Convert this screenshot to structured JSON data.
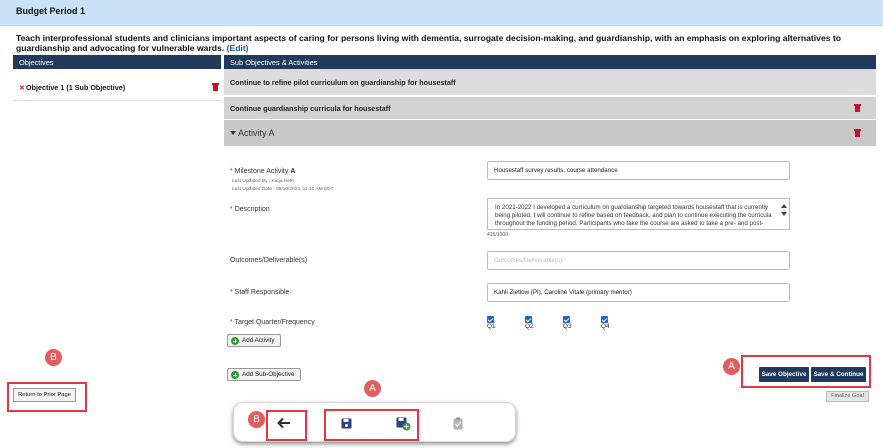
{
  "header": {
    "period_title": "Budget Period 1",
    "goal_text": "Teach interprofessional students and clinicians important aspects of caring for persons living with dementia, surrogate decision-making, and guardianship, with an emphasis on exploring alternatives to guardianship and advocating for vulnerable wards.",
    "edit_link": "(Edit)"
  },
  "columns": {
    "objectives": "Objectives",
    "sub_objectives": "Sub Objectives & Activities"
  },
  "objectives": [
    {
      "label": "Objective 1 (1 Sub Objective)"
    }
  ],
  "sub_objective": {
    "parent_label": "Continue to refine pilot curriculum on guardianship for housestaff",
    "label": "Continue guardianship curricula for housestaff"
  },
  "activity": {
    "title": "Activity A",
    "milestone_label": "Milestone Activity",
    "milestone_letter": "A",
    "last_updated_by": "Last Updated By : Katja Heth",
    "last_updated_date": "Last Updated Date : 08/10/2023, 11:10 AM EDT",
    "milestone_value": "Housestaff survey results, course attendance",
    "description_label": "Description",
    "description_value": "In 2021-2022 I developed a curriculum on guardianship targeted towards housestaff that is currently being piloted. I will continue to refine based on feedback, and plan to continue executing the curricula throughout the funding period. Participants who take the course are asked to take a pre- and post-",
    "char_count": "415/1000",
    "outcomes_label": "Outcomes/Deliverable(s)",
    "outcomes_placeholder": "Outcomes/Deliverable(s)",
    "staff_label": "Staff Responsible",
    "staff_value": "Kahli Zietlow (PI), Caroline Vitale (primary mentor)",
    "target_label": "Target Quarter/Frequency",
    "quarters": [
      "Q1",
      "Q2",
      "Q3",
      "Q4"
    ]
  },
  "buttons": {
    "add_activity": "Add Activity",
    "add_sub_objective": "Add Sub-Objective",
    "save_objective": "Save Objective",
    "save_continue": "Save & Continue",
    "finalize_goal": "Finalize Goal",
    "return_prior": "Return to Prior Page"
  },
  "annotations": {
    "marker_a": "A",
    "marker_b": "B"
  },
  "colors": {
    "header_navy": "#1f3a5b",
    "period_bar": "#c9e2f7",
    "delete_red": "#c8102e",
    "annotation_red": "#e0383e",
    "checkbox_blue": "#1a66c2"
  },
  "icons": {
    "back": "arrow-left-icon",
    "save": "floppy-disk-icon",
    "save_add": "floppy-disk-plus-icon",
    "finalize": "clipboard-check-icon",
    "delete": "trash-icon"
  }
}
